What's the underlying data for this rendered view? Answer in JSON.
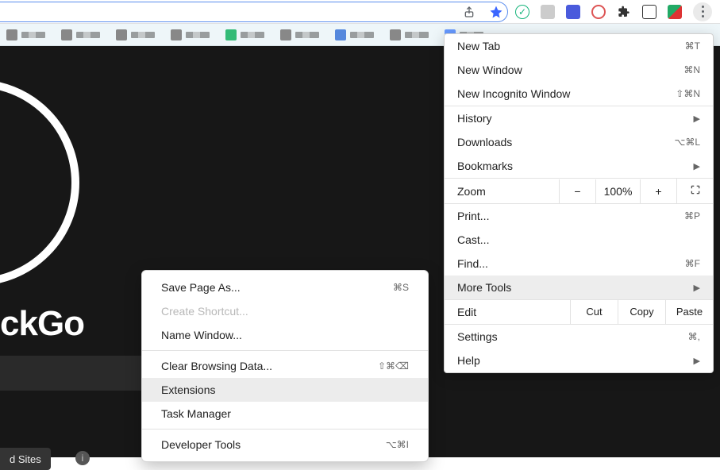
{
  "toolbar": {
    "share_icon": "share-icon",
    "star_icon": "star-icon",
    "menu_icon": "menu-dots"
  },
  "page": {
    "brand_fragment": "ckGo",
    "button_sites": "d Sites"
  },
  "menu": {
    "new_tab": {
      "label": "New Tab",
      "shortcut": "⌘T"
    },
    "new_window": {
      "label": "New Window",
      "shortcut": "⌘N"
    },
    "new_incognito": {
      "label": "New Incognito Window",
      "shortcut": "⇧⌘N"
    },
    "history": {
      "label": "History"
    },
    "downloads": {
      "label": "Downloads",
      "shortcut": "⌥⌘L"
    },
    "bookmarks": {
      "label": "Bookmarks"
    },
    "zoom": {
      "label": "Zoom",
      "minus": "−",
      "pct": "100%",
      "plus": "+"
    },
    "print": {
      "label": "Print...",
      "shortcut": "⌘P"
    },
    "cast": {
      "label": "Cast..."
    },
    "find": {
      "label": "Find...",
      "shortcut": "⌘F"
    },
    "more_tools": {
      "label": "More Tools"
    },
    "edit": {
      "label": "Edit",
      "cut": "Cut",
      "copy": "Copy",
      "paste": "Paste"
    },
    "settings": {
      "label": "Settings",
      "shortcut": "⌘,"
    },
    "help": {
      "label": "Help"
    }
  },
  "submenu": {
    "save_page": {
      "label": "Save Page As...",
      "shortcut": "⌘S"
    },
    "create_shortcut": {
      "label": "Create Shortcut..."
    },
    "name_window": {
      "label": "Name Window..."
    },
    "clear_browsing": {
      "label": "Clear Browsing Data...",
      "shortcut": "⇧⌘⌫"
    },
    "extensions": {
      "label": "Extensions"
    },
    "task_manager": {
      "label": "Task Manager"
    },
    "dev_tools": {
      "label": "Developer Tools",
      "shortcut": "⌥⌘I"
    }
  }
}
